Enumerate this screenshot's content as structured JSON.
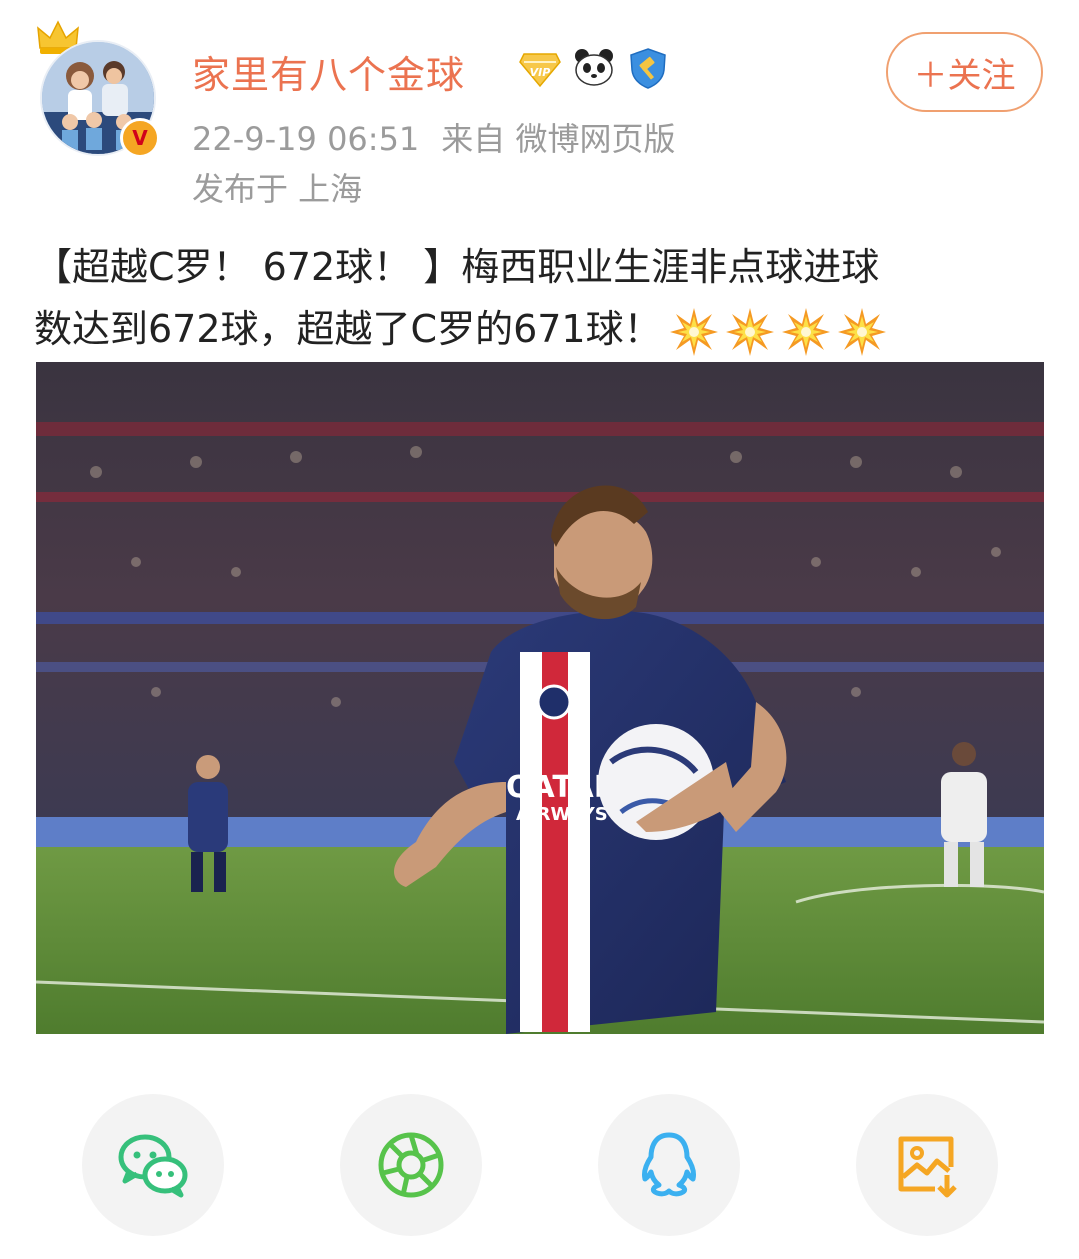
{
  "post": {
    "author": {
      "name": "家里有八个金球",
      "verified_mark": "V",
      "badges": [
        "vip-crown-icon",
        "panda-icon",
        "shield-hammer-icon"
      ]
    },
    "timestamp": "22-9-19 06:51",
    "source": "来自 微博网页版",
    "location": "发布于 上海",
    "follow_label": "＋关注",
    "text_line1": "【超越C罗！ 672球！ 】梅西职业生涯非点球进球",
    "text_line2": "数达到672球，超越了C罗的671球！",
    "emojis": [
      "burst-emoji",
      "burst-emoji",
      "burst-emoji",
      "burst-emoji"
    ]
  },
  "share": {
    "items": [
      {
        "name": "wechat",
        "icon": "wechat-icon",
        "color": "#36c07b"
      },
      {
        "name": "moments",
        "icon": "moments-icon",
        "color": "#57c34b"
      },
      {
        "name": "qq",
        "icon": "qq-icon",
        "color": "#3bb0f0"
      },
      {
        "name": "save-image",
        "icon": "save-image-icon",
        "color": "#f5a623"
      }
    ]
  },
  "colors": {
    "accent": "#eb7350",
    "meta": "#9b9b9b"
  }
}
